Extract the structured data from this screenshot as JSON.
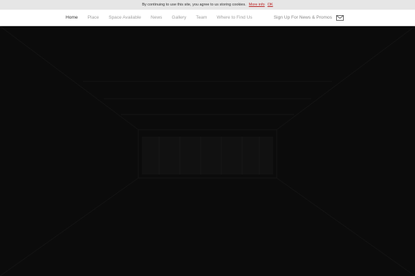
{
  "cookie_bar": {
    "message": "By continuing to use this site, you agree to us storing cookies.",
    "more_info_label": "More info",
    "ok_label": "OK"
  },
  "nav": {
    "items": [
      {
        "label": "Home",
        "active": true
      },
      {
        "label": "Place",
        "active": false
      },
      {
        "label": "Space Available",
        "active": false
      },
      {
        "label": "News",
        "active": false
      },
      {
        "label": "Gallery",
        "active": false
      },
      {
        "label": "Team",
        "active": false
      },
      {
        "label": "Where to Find Us",
        "active": false
      }
    ],
    "signup_label": "Sign Up For News & Promos",
    "signup_icon": "mail-icon"
  },
  "hero": {
    "background_color": "#0b0b0b"
  }
}
